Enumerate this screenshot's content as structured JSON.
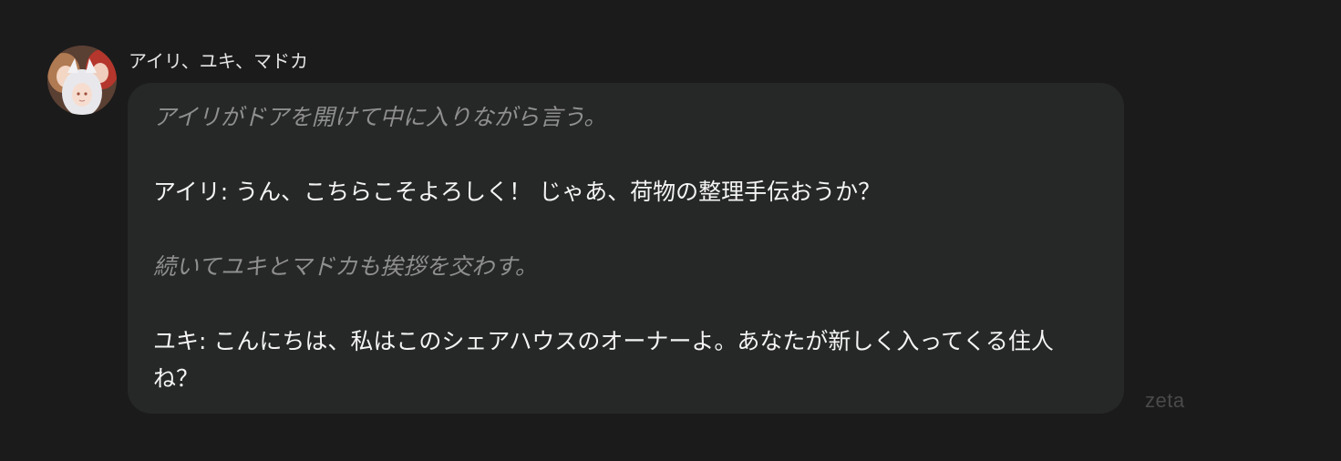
{
  "message": {
    "sender": "アイリ、ユキ、マドカ",
    "avatar_icon": "group-avatar-icon",
    "lines": [
      {
        "type": "narration",
        "text": "アイリがドアを開けて中に入りながら言う。"
      },
      {
        "type": "dialogue",
        "text": "アイリ: うん、こちらこそよろしく！ じゃあ、荷物の整理手伝おうか？"
      },
      {
        "type": "narration",
        "text": "続いてユキとマドカも挨拶を交わす。"
      },
      {
        "type": "dialogue",
        "text": "ユキ: こんにちは、私はこのシェアハウスのオーナーよ。あなたが新しく入ってくる住人ね？"
      }
    ]
  },
  "watermark": "zeta",
  "colors": {
    "background": "#1b1b1b",
    "bubble": "#262727",
    "narration_text": "#8f8f8f",
    "dialogue_text": "#f4f4f4"
  }
}
